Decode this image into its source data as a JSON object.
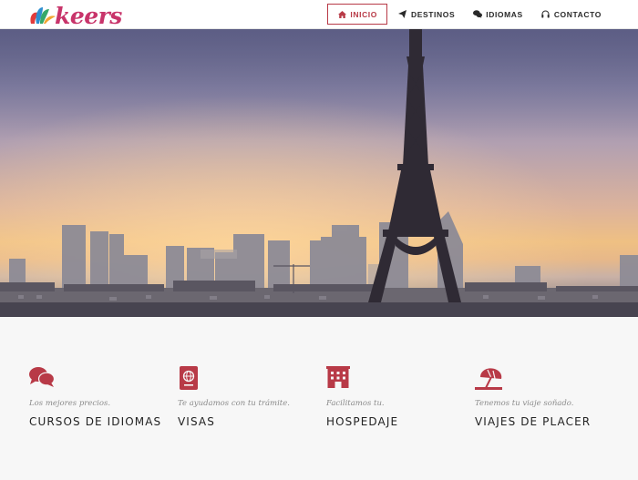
{
  "brand": {
    "logo_text": "keers",
    "colors": {
      "accent": "#b83a47",
      "logo_pink": "#c8346a"
    }
  },
  "nav": {
    "items": [
      {
        "label": "INICIO",
        "icon": "home-icon",
        "active": true
      },
      {
        "label": "DESTINOS",
        "icon": "paper-plane-icon",
        "active": false
      },
      {
        "label": "IDIOMAS",
        "icon": "comments-icon",
        "active": false
      },
      {
        "label": "CONTACTO",
        "icon": "headphones-icon",
        "active": false
      }
    ]
  },
  "hero": {
    "image": "paris-eiffel-tower-sunset"
  },
  "features": [
    {
      "icon": "comments-icon",
      "subtitle": "Los mejores precios.",
      "title": "CURSOS DE IDIOMAS"
    },
    {
      "icon": "passport-icon",
      "subtitle": "Te ayudamos con tu trámite.",
      "title": "VISAS"
    },
    {
      "icon": "hotel-icon",
      "subtitle": "Facilitamos tu.",
      "title": "HOSPEDAJE"
    },
    {
      "icon": "umbrella-beach-icon",
      "subtitle": "Tenemos tu viaje soñado.",
      "title": "VIAJES DE PLACER"
    }
  ]
}
